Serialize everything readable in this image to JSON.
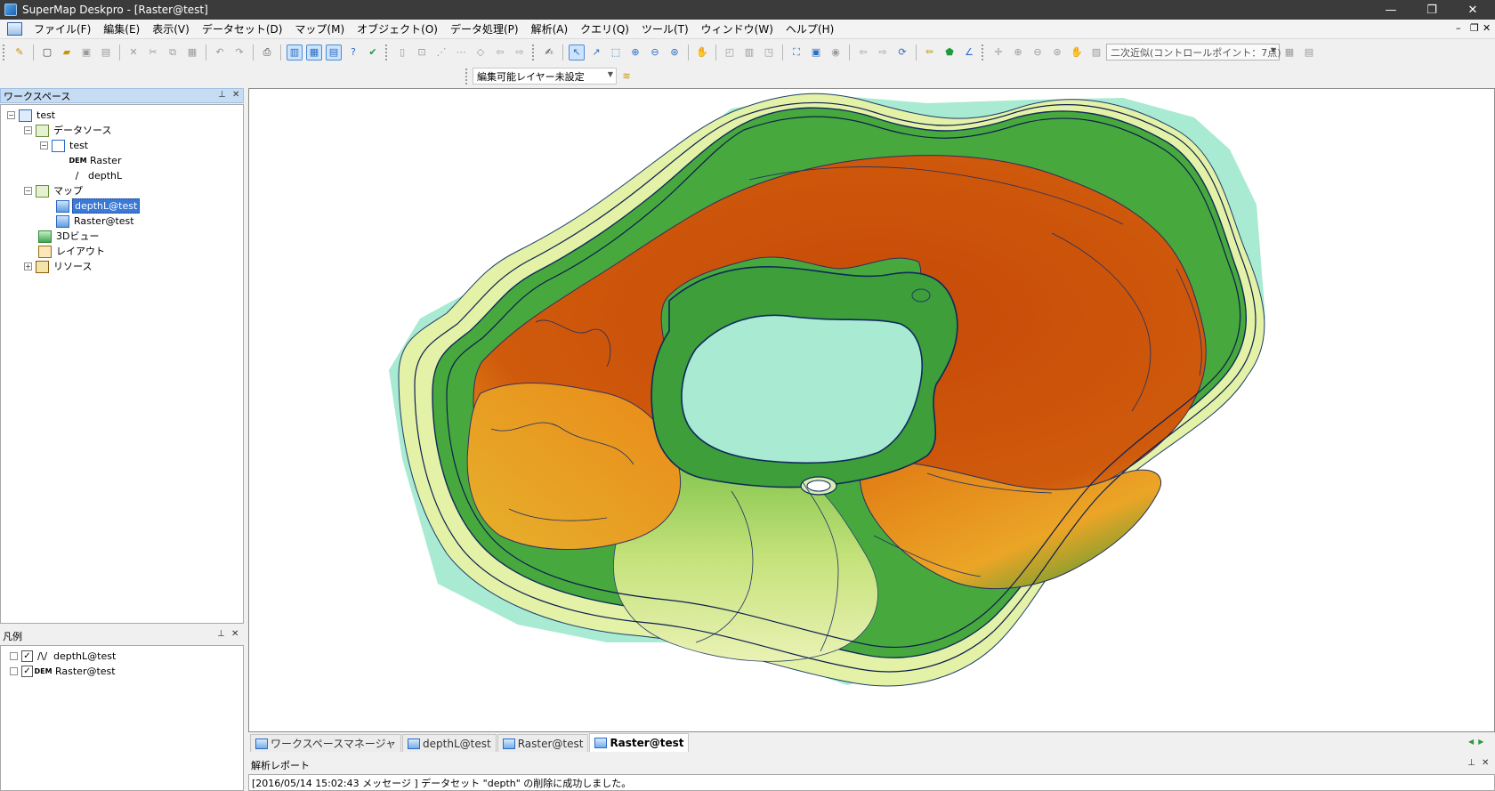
{
  "window": {
    "title": "SuperMap Deskpro - [Raster@test]"
  },
  "menu": [
    {
      "name": "file",
      "label": "ファイル(F)"
    },
    {
      "name": "edit",
      "label": "編集(E)"
    },
    {
      "name": "view",
      "label": "表示(V)"
    },
    {
      "name": "dataset",
      "label": "データセット(D)"
    },
    {
      "name": "map",
      "label": "マップ(M)"
    },
    {
      "name": "object",
      "label": "オブジェクト(O)"
    },
    {
      "name": "data-processing",
      "label": "データ処理(P)"
    },
    {
      "name": "analysis",
      "label": "解析(A)"
    },
    {
      "name": "query",
      "label": "クエリ(Q)"
    },
    {
      "name": "tools",
      "label": "ツール(T)"
    },
    {
      "name": "window",
      "label": "ウィンドウ(W)"
    },
    {
      "name": "help",
      "label": "ヘルプ(H)"
    }
  ],
  "toolbar": {
    "transform_method": "二次近似(コントロールポイント：7点)",
    "edit_layer": "編集可能レイヤー未設定"
  },
  "workspace_panel": {
    "title": "ワークスペース",
    "root": "test",
    "datasources_label": "データソース",
    "datasource_name": "test",
    "datasets": [
      {
        "badge": "DEM",
        "name": "Raster"
      },
      {
        "badge": "∕",
        "name": "depthL"
      }
    ],
    "maps_label": "マップ",
    "maps": [
      "depthL@test",
      "Raster@test"
    ],
    "scenes_label": "3Dビュー",
    "layouts_label": "レイアウト",
    "resources_label": "リソース"
  },
  "legend_panel": {
    "title": "凡例",
    "layers": [
      {
        "badge": "∕\\∕",
        "name": "depthL@test",
        "checked": true
      },
      {
        "badge": "DEM",
        "name": "Raster@test",
        "checked": true
      }
    ]
  },
  "tabs": [
    {
      "label": "ワークスペースマネージャ",
      "active": false
    },
    {
      "label": "depthL@test",
      "active": false
    },
    {
      "label": "Raster@test",
      "active": false
    },
    {
      "label": "Raster@test",
      "active": true
    }
  ],
  "output_panel": {
    "title": "解析レポート",
    "message": "[2016/05/14 15:02:43   メッセージ ] データセット \"depth\" の削除に成功しました。"
  },
  "colors": {
    "title_bar": "#3b3b3b",
    "selection": "#3a79d6",
    "raster_deep": "#c8500a",
    "raster_mid": "#e8a018",
    "raster_green": "#2f9a38",
    "raster_shallow": "#a8ead2"
  }
}
